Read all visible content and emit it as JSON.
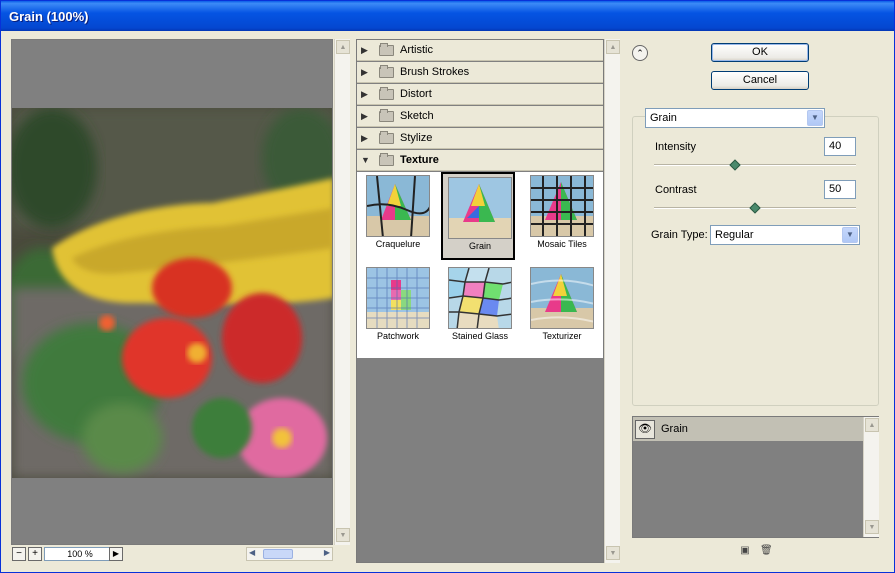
{
  "window": {
    "title": "Grain (100%)"
  },
  "preview": {
    "zoom_out": "−",
    "zoom_in": "+",
    "zoom_level": "100 %"
  },
  "gallery": {
    "categories": [
      {
        "label": "Artistic",
        "open": false
      },
      {
        "label": "Brush Strokes",
        "open": false
      },
      {
        "label": "Distort",
        "open": false
      },
      {
        "label": "Sketch",
        "open": false
      },
      {
        "label": "Stylize",
        "open": false
      },
      {
        "label": "Texture",
        "open": true
      }
    ],
    "filters": [
      {
        "label": "Craquelure"
      },
      {
        "label": "Grain",
        "selected": true
      },
      {
        "label": "Mosaic Tiles"
      },
      {
        "label": "Patchwork"
      },
      {
        "label": "Stained Glass"
      },
      {
        "label": "Texturizer"
      }
    ]
  },
  "buttons": {
    "ok": "OK",
    "cancel": "Cancel"
  },
  "settings": {
    "filter_select": "Grain",
    "intensity_label": "Intensity",
    "intensity_value": "40",
    "intensity_max": 100,
    "contrast_label": "Contrast",
    "contrast_value": "50",
    "contrast_max": 100,
    "grain_type_label": "Grain Type:",
    "grain_type_value": "Regular"
  },
  "layers": {
    "items": [
      {
        "name": "Grain",
        "visible": true
      }
    ]
  },
  "icons": {
    "expand": "collapse-up-icon",
    "new_layer": "new-effect-layer-icon",
    "delete_layer": "trash-icon",
    "eye": "eye-icon"
  }
}
